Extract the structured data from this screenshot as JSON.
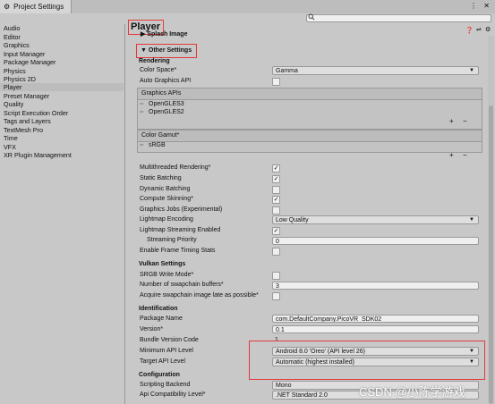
{
  "window": {
    "title": "Project Settings",
    "menu_icon": "⋮",
    "close_icon": "✕"
  },
  "search": {
    "placeholder": "",
    "icon": "search-icon"
  },
  "sidebar": {
    "items": [
      {
        "label": "Audio"
      },
      {
        "label": "Editor"
      },
      {
        "label": "Graphics"
      },
      {
        "label": "Input Manager"
      },
      {
        "label": "Package Manager"
      },
      {
        "label": "Physics"
      },
      {
        "label": "Physics 2D"
      },
      {
        "label": "Player",
        "selected": true
      },
      {
        "label": "Preset Manager"
      },
      {
        "label": "Quality"
      },
      {
        "label": "Script Execution Order"
      },
      {
        "label": "Tags and Layers"
      },
      {
        "label": "TextMesh Pro"
      },
      {
        "label": "Time"
      },
      {
        "label": "VFX"
      },
      {
        "label": "XR Plugin Management"
      }
    ]
  },
  "main": {
    "title": "Player",
    "splash_foldout": "Splash Image",
    "other_settings_foldout": "Other Settings",
    "rendering": {
      "header": "Rendering",
      "color_space_label": "Color Space*",
      "color_space_value": "Gamma",
      "auto_graphics_api_label": "Auto Graphics API",
      "auto_graphics_api_checked": false,
      "graphics_apis_header": "Graphics APIs",
      "graphics_apis": [
        "OpenGLES3",
        "OpenGLES2"
      ],
      "color_gamut_header": "Color Gamut*",
      "color_gamut": [
        "sRGB"
      ],
      "plus": "+",
      "minus": "−",
      "toggles": [
        {
          "label": "Multithreaded Rendering*",
          "checked": true
        },
        {
          "label": "Static Batching",
          "checked": true
        },
        {
          "label": "Dynamic Batching",
          "checked": false
        },
        {
          "label": "Compute Skinning*",
          "checked": true
        },
        {
          "label": "Graphics Jobs (Experimental)",
          "checked": false
        }
      ],
      "lightmap_encoding_label": "Lightmap Encoding",
      "lightmap_encoding_value": "Low Quality",
      "lightmap_streaming_label": "Lightmap Streaming Enabled",
      "lightmap_streaming_checked": true,
      "streaming_priority_label": "Streaming Priority",
      "streaming_priority_value": "0",
      "frame_timing_label": "Enable Frame Timing Stats",
      "frame_timing_checked": false
    },
    "vulkan": {
      "header": "Vulkan Settings",
      "srgb_write_label": "SRGB Write Mode*",
      "srgb_write_checked": false,
      "swapchain_buffers_label": "Number of swapchain buffers*",
      "swapchain_buffers_value": "3",
      "acquire_late_label": "Acquire swapchain image late as possible*",
      "acquire_late_checked": false
    },
    "identification": {
      "header": "Identification",
      "package_name_label": "Package Name",
      "package_name_value": "com.DefaultCompany.PicoVR_SDK02",
      "version_label": "Version*",
      "version_value": "0.1",
      "bundle_version_label": "Bundle Version Code",
      "bundle_version_value": "1",
      "min_api_label": "Minimum API Level",
      "min_api_value": "Android 8.0 'Oreo' (API level 26)",
      "target_api_label": "Target API Level",
      "target_api_value": "Automatic (highest installed)"
    },
    "configuration": {
      "header": "Configuration",
      "scripting_backend_label": "Scripting Backend",
      "scripting_backend_value": "Mono",
      "api_compat_label": "Api Compatibility Level*",
      "api_compat_value": ".NET Standard 2.0"
    }
  },
  "watermark": "CSDN @小陈学游戏",
  "colors": {
    "highlight_box": "#e2393b",
    "background": "#c8c8c8"
  }
}
